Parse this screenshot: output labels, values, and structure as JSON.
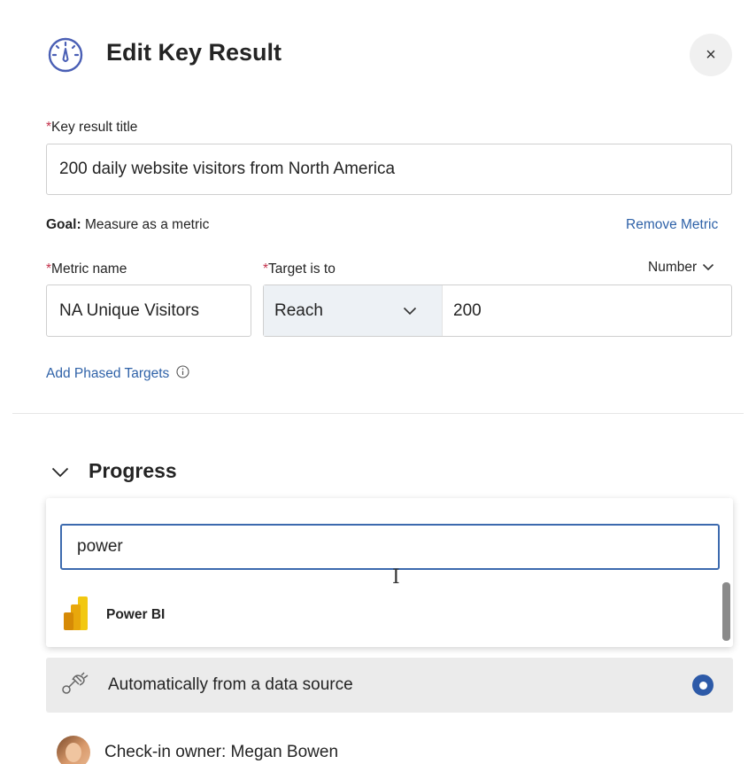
{
  "header": {
    "title": "Edit Key Result",
    "icon": "gauge-icon",
    "close_label": "×"
  },
  "key_result": {
    "label": "Key result title",
    "required_mark": "*",
    "value": "200 daily website visitors from North America"
  },
  "goal": {
    "prefix": "Goal:",
    "text": "Measure as a metric",
    "remove_link": "Remove Metric"
  },
  "metric": {
    "label": "Metric name",
    "required_mark": "*",
    "value": "NA Unique Visitors"
  },
  "target": {
    "label": "Target is to",
    "required_mark": "*",
    "type_label": "Number",
    "operator": "Reach",
    "value": "200"
  },
  "phased_targets_link": "Add Phased Targets",
  "progress": {
    "title": "Progress",
    "search_value": "power",
    "results": [
      {
        "label": "Power BI",
        "icon": "power-bi-icon"
      }
    ],
    "data_source_option": "Automatically from a data source",
    "data_source_selected": true
  },
  "owner": {
    "text": "Check-in owner: Megan Bowen"
  },
  "colors": {
    "accent": "#2d5aa8",
    "link": "#2f62a8",
    "required": "#c4314b"
  }
}
